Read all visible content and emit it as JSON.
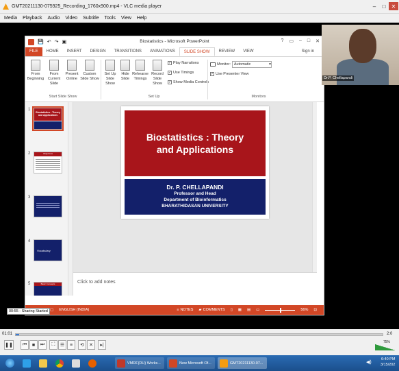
{
  "vlc": {
    "title": "GMT20211130-075925_Recording_1760x900.mp4 - VLC media player",
    "menu": [
      "Media",
      "Playback",
      "Audio",
      "Video",
      "Subtitle",
      "Tools",
      "View",
      "Help"
    ],
    "time_elapsed": "01:01",
    "time_total": "2:0",
    "volume": "75%",
    "progress_fraction": 0.01
  },
  "ppt": {
    "doc_title": "Biostatistics - Microsoft PowerPoint",
    "tabs": [
      "FILE",
      "HOME",
      "INSERT",
      "DESIGN",
      "TRANSITIONS",
      "ANIMATIONS",
      "SLIDE SHOW",
      "REVIEW",
      "VIEW"
    ],
    "active_tab": "SLIDE SHOW",
    "sign_in": "Sign in",
    "ribbon": {
      "from_beginning": "From Beginning",
      "from_current": "From Current Slide",
      "present_online": "Present Online",
      "custom_slide_show": "Custom Slide Show",
      "group1": "Start Slide Show",
      "set_up_show": "Set Up Slide Show",
      "hide_slide": "Hide Slide",
      "rehearse": "Rehearse Timings",
      "record": "Record Slide Show",
      "play_narrations": "Play Narrations",
      "use_timings": "Use Timings",
      "show_media": "Show Media Controls",
      "group2": "Set Up",
      "monitor_label": "Monitor:",
      "monitor_value": "Automatic",
      "presenter_view": "Use Presenter View",
      "group3": "Monitors"
    },
    "thumb_numbers": [
      "1",
      "2",
      "3",
      "4",
      "5"
    ],
    "thumb_texts": [
      "Biostatistics : Theory and Applications",
      "Objectives",
      "",
      "Vocabulary",
      "Basic Concepts"
    ],
    "slide": {
      "title": "Biostatistics : Theory and Applications",
      "author": "Dr. P. CHELLAPANDI",
      "role": "Professor and Head",
      "dept": "Department of Bioinformatics",
      "university": "BHARATHIDASAN UNIVERSITY"
    },
    "notes_placeholder": "Click to add notes",
    "status": {
      "language": "ENGLISH (INDIA)",
      "notes": "NOTES",
      "comments": "COMMENTS",
      "zoom": "56%"
    }
  },
  "webcam": {
    "name": "Dr.P. Chellapandi"
  },
  "sharing_label": "00:55 - Sharing Started",
  "taskbar": {
    "items": [
      "VMRF(DU) Works...",
      "New Microsoft Of...",
      "GMT20211130-07..."
    ],
    "time": "6:40 PM",
    "date": "3/15/202"
  },
  "colors": {
    "ppt_accent": "#d24726",
    "slide_red": "#a8151b",
    "slide_blue": "#13206a"
  }
}
